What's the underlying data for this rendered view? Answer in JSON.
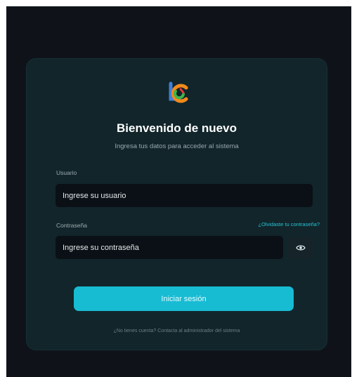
{
  "login": {
    "title": "Bienvenido de nuevo",
    "subtitle": "Ingresa tus datos para acceder al sistema",
    "username_label": "Usuario",
    "username_placeholder": "Ingrese su usuario",
    "password_label": "Contraseña",
    "forgot_link": "¿Olvidaste tu contraseña?",
    "password_placeholder": "Ingrese su contraseña",
    "submit_label": "Iniciar sesión",
    "footer_text": "¿No tienes cuenta? Contacta al administrador del sistema"
  },
  "icons": {
    "logo": "lc-logo-icon",
    "toggle_password": "eye-icon"
  },
  "colors": {
    "background": "#0f1319",
    "card": "#11252a",
    "accent": "#17bcd3",
    "link": "#27c3d8"
  }
}
